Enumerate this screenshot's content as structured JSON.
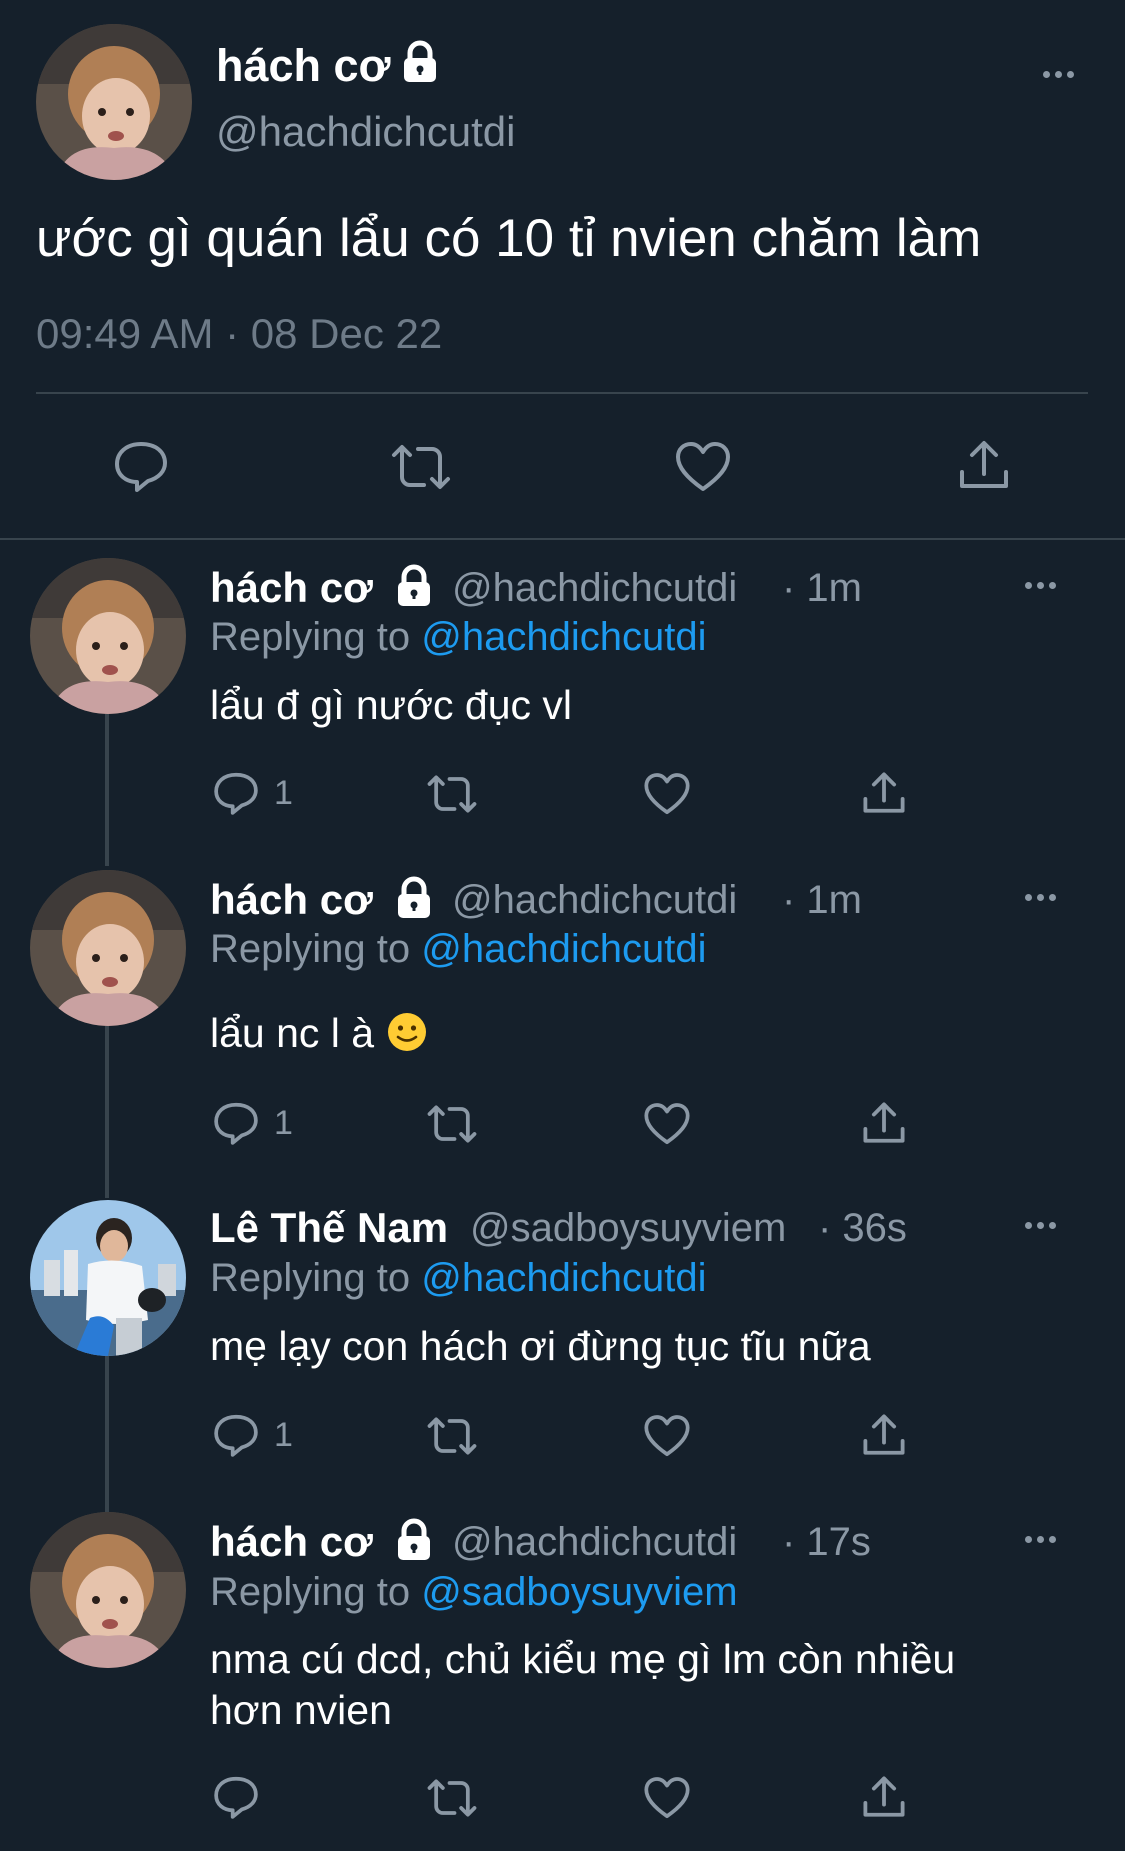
{
  "main_tweet": {
    "name": "hách cơ",
    "handle": "@hachdichcutdi",
    "text": "ước gì quán lẩu có 10 tỉ nvien chăm làm",
    "timestamp": "09:49 AM · 08 Dec 22"
  },
  "action_icons": [
    "reply-icon",
    "retweet-icon",
    "like-icon",
    "share-icon"
  ],
  "replies": [
    {
      "name": "hách cơ",
      "handle": "@hachdichcutdi",
      "time": "· 1m",
      "replying_label": "Replying to",
      "replying_to": "@hachdichcutdi",
      "text": "lẩu đ gì nước đục vl",
      "reply_count": "1"
    },
    {
      "name": "hách cơ",
      "handle": "@hachdichcutdi",
      "time": "· 1m",
      "replying_label": "Replying to",
      "replying_to": "@hachdichcutdi",
      "text": "lẩu nc l à",
      "emoji": "slightly-smiling-face",
      "reply_count": "1"
    },
    {
      "name": "Lê Thế Nam",
      "handle": "@sadboysuyviem",
      "time": "· 36s",
      "replying_label": "Replying to",
      "replying_to": "@hachdichcutdi",
      "text": "mẹ lạy con hách ơi đừng tục tĩu nữa",
      "reply_count": "1"
    },
    {
      "name": "hách cơ",
      "handle": "@hachdichcutdi",
      "time": "· 17s",
      "replying_label": "Replying to",
      "replying_to": "@sadboysuyviem",
      "text_line1": "nma cú dcd, chủ kiểu mẹ gì lm còn nhiều",
      "text_line2": "hơn nvien",
      "reply_count": ""
    }
  ],
  "colors": {
    "background": "#15202b",
    "text": "#ffffff",
    "secondary": "#8b98a5",
    "link": "#1d9bf0",
    "divider": "#38444d"
  }
}
